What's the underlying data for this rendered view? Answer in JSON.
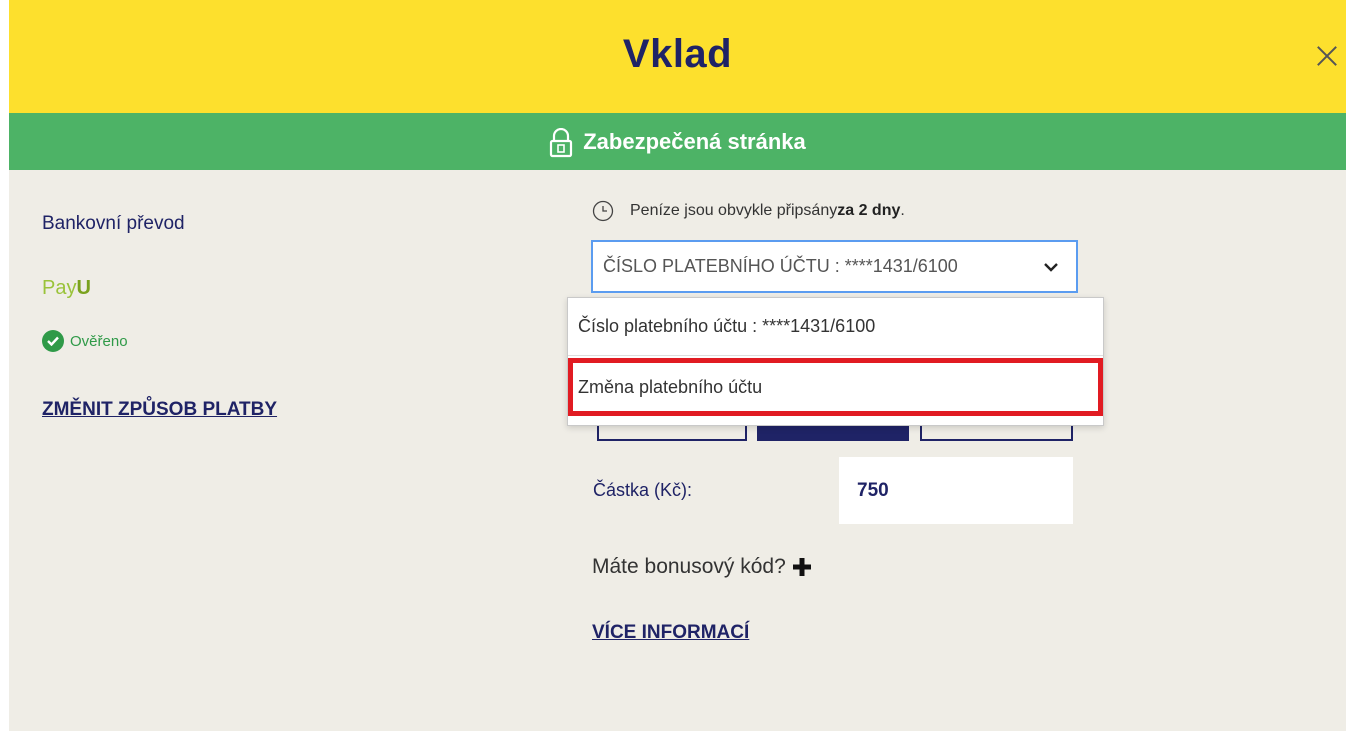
{
  "header": {
    "title": "Vklad",
    "close_icon": "close-icon"
  },
  "secure_bar": {
    "label": "Zabezpečená stránka",
    "icon": "lock-icon"
  },
  "left": {
    "method_label": "Bankovní převod",
    "payu_logo": "PayU",
    "verified_label": "Ověřeno",
    "change_method_link": "ZMĚNIT ZPŮSOB PLATBY"
  },
  "info": {
    "text_prefix": "Peníze jsou obvykle připsány ",
    "text_bold": "za 2 dny",
    "text_suffix": "."
  },
  "account_select": {
    "selected": "ČÍSLO PLATEBNÍHO ÚČTU : ****1431/6100",
    "options": [
      "Číslo platebního účtu : ****1431/6100",
      "Změna platebního účtu"
    ]
  },
  "amount": {
    "label": "Částka (Kč):",
    "value": "750"
  },
  "bonus": {
    "label": "Máte bonusový kód?"
  },
  "more_info_link": "VÍCE INFORMACÍ",
  "colors": {
    "header_bg": "#fde02d",
    "secure_bg": "#4db366",
    "brand_navy": "#1f2366",
    "highlight_red": "#e11b22",
    "select_border": "#5b9cf0"
  }
}
